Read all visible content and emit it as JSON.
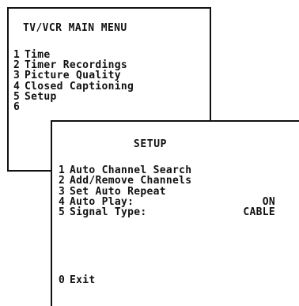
{
  "main_menu": {
    "title": "TV/VCR MAIN MENU",
    "items": [
      {
        "num": "1",
        "label": "Time"
      },
      {
        "num": "2",
        "label": "Timer Recordings"
      },
      {
        "num": "3",
        "label": "Picture Quality"
      },
      {
        "num": "4",
        "label": "Closed Captioning"
      },
      {
        "num": "5",
        "label": "Setup"
      },
      {
        "num": "6",
        "label": ""
      }
    ]
  },
  "setup_menu": {
    "title": "SETUP",
    "items": [
      {
        "num": "1",
        "label": "Auto Channel Search",
        "value": ""
      },
      {
        "num": "2",
        "label": "Add/Remove Channels",
        "value": ""
      },
      {
        "num": "3",
        "label": "Set Auto Repeat",
        "value": ""
      },
      {
        "num": "4",
        "label": "Auto Play:",
        "value": "ON"
      },
      {
        "num": "5",
        "label": "Signal Type:",
        "value": "CABLE"
      }
    ],
    "exit": {
      "num": "0",
      "label": "Exit"
    }
  }
}
